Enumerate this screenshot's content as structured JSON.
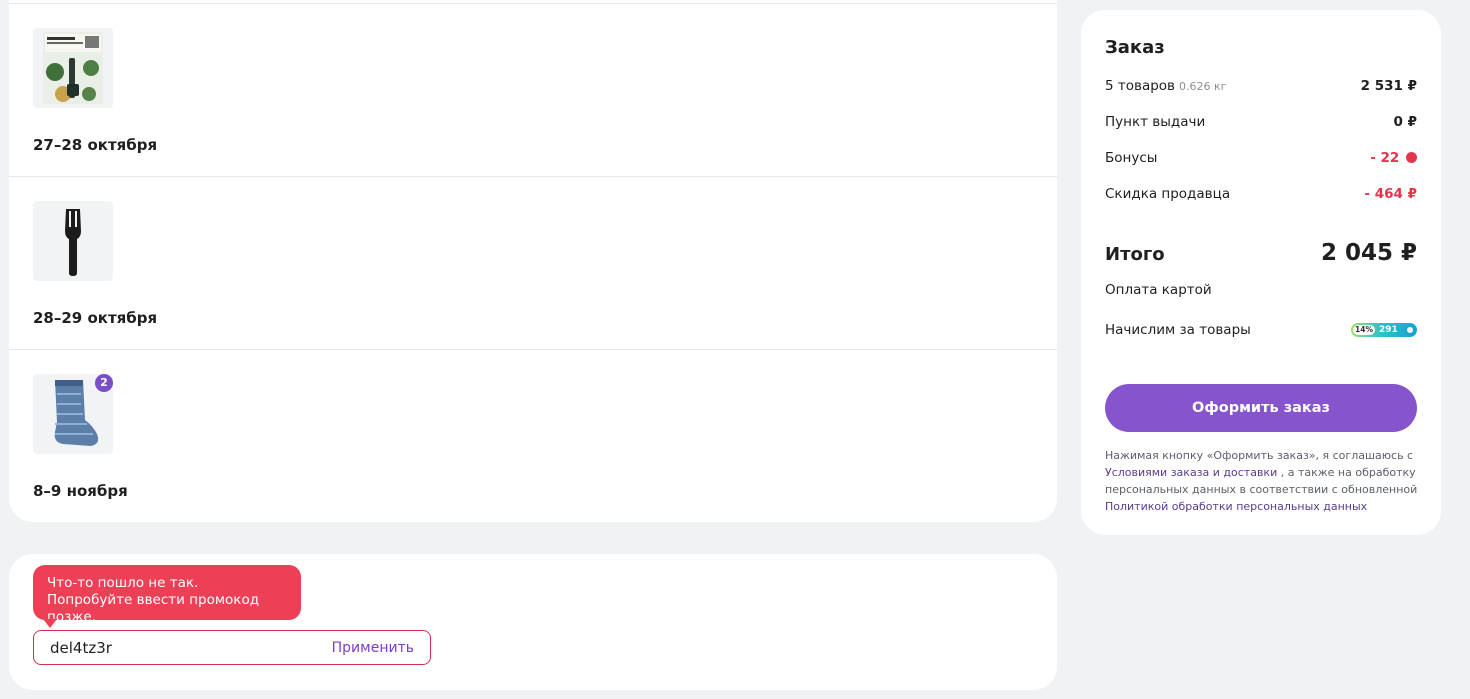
{
  "deliveries": [
    {
      "date": "27–28 октября",
      "product": "Книга «Азиатская кухня»",
      "badge": ""
    },
    {
      "date": "28–29 октября",
      "product": "Лопатка кухонная",
      "badge": ""
    },
    {
      "date": "8–9 ноября",
      "product": "Носки",
      "badge": "2"
    }
  ],
  "promo": {
    "error_tooltip": "Что-то пошло не так. Попробуйте ввести промокод позже.",
    "value": "del4tz3r",
    "apply_label": "Применить"
  },
  "summary": {
    "title": "Заказ",
    "items_label": "5 товаров",
    "items_weight": "0.626 кг",
    "items_price": "2 531 ₽",
    "pickup_label": "Пункт выдачи",
    "pickup_price": "0 ₽",
    "bonuses_label": "Бонусы",
    "bonuses_value": "- 22",
    "seller_discount_label": "Скидка продавца",
    "seller_discount_value": "- 464 ₽",
    "total_label": "Итого",
    "total_value": "2 045 ₽",
    "payment_label": "Оплата картой",
    "accrue_label": "Начислим за товары",
    "accrue_percent": "14%",
    "accrue_amount": "291",
    "checkout_label": "Оформить заказ",
    "legal_prefix": "Нажимая кнопку «Оформить заказ», я соглашаюсь с",
    "legal_link1": "Условиями заказа и доставки",
    "legal_middle": ", а также на обработку персональных данных в соответствии с обновленной",
    "legal_link2": "Политикой обработки персональных данных"
  },
  "colors": {
    "accent": "#8654cc",
    "error": "#ed4057",
    "negative": "#e5354b"
  }
}
